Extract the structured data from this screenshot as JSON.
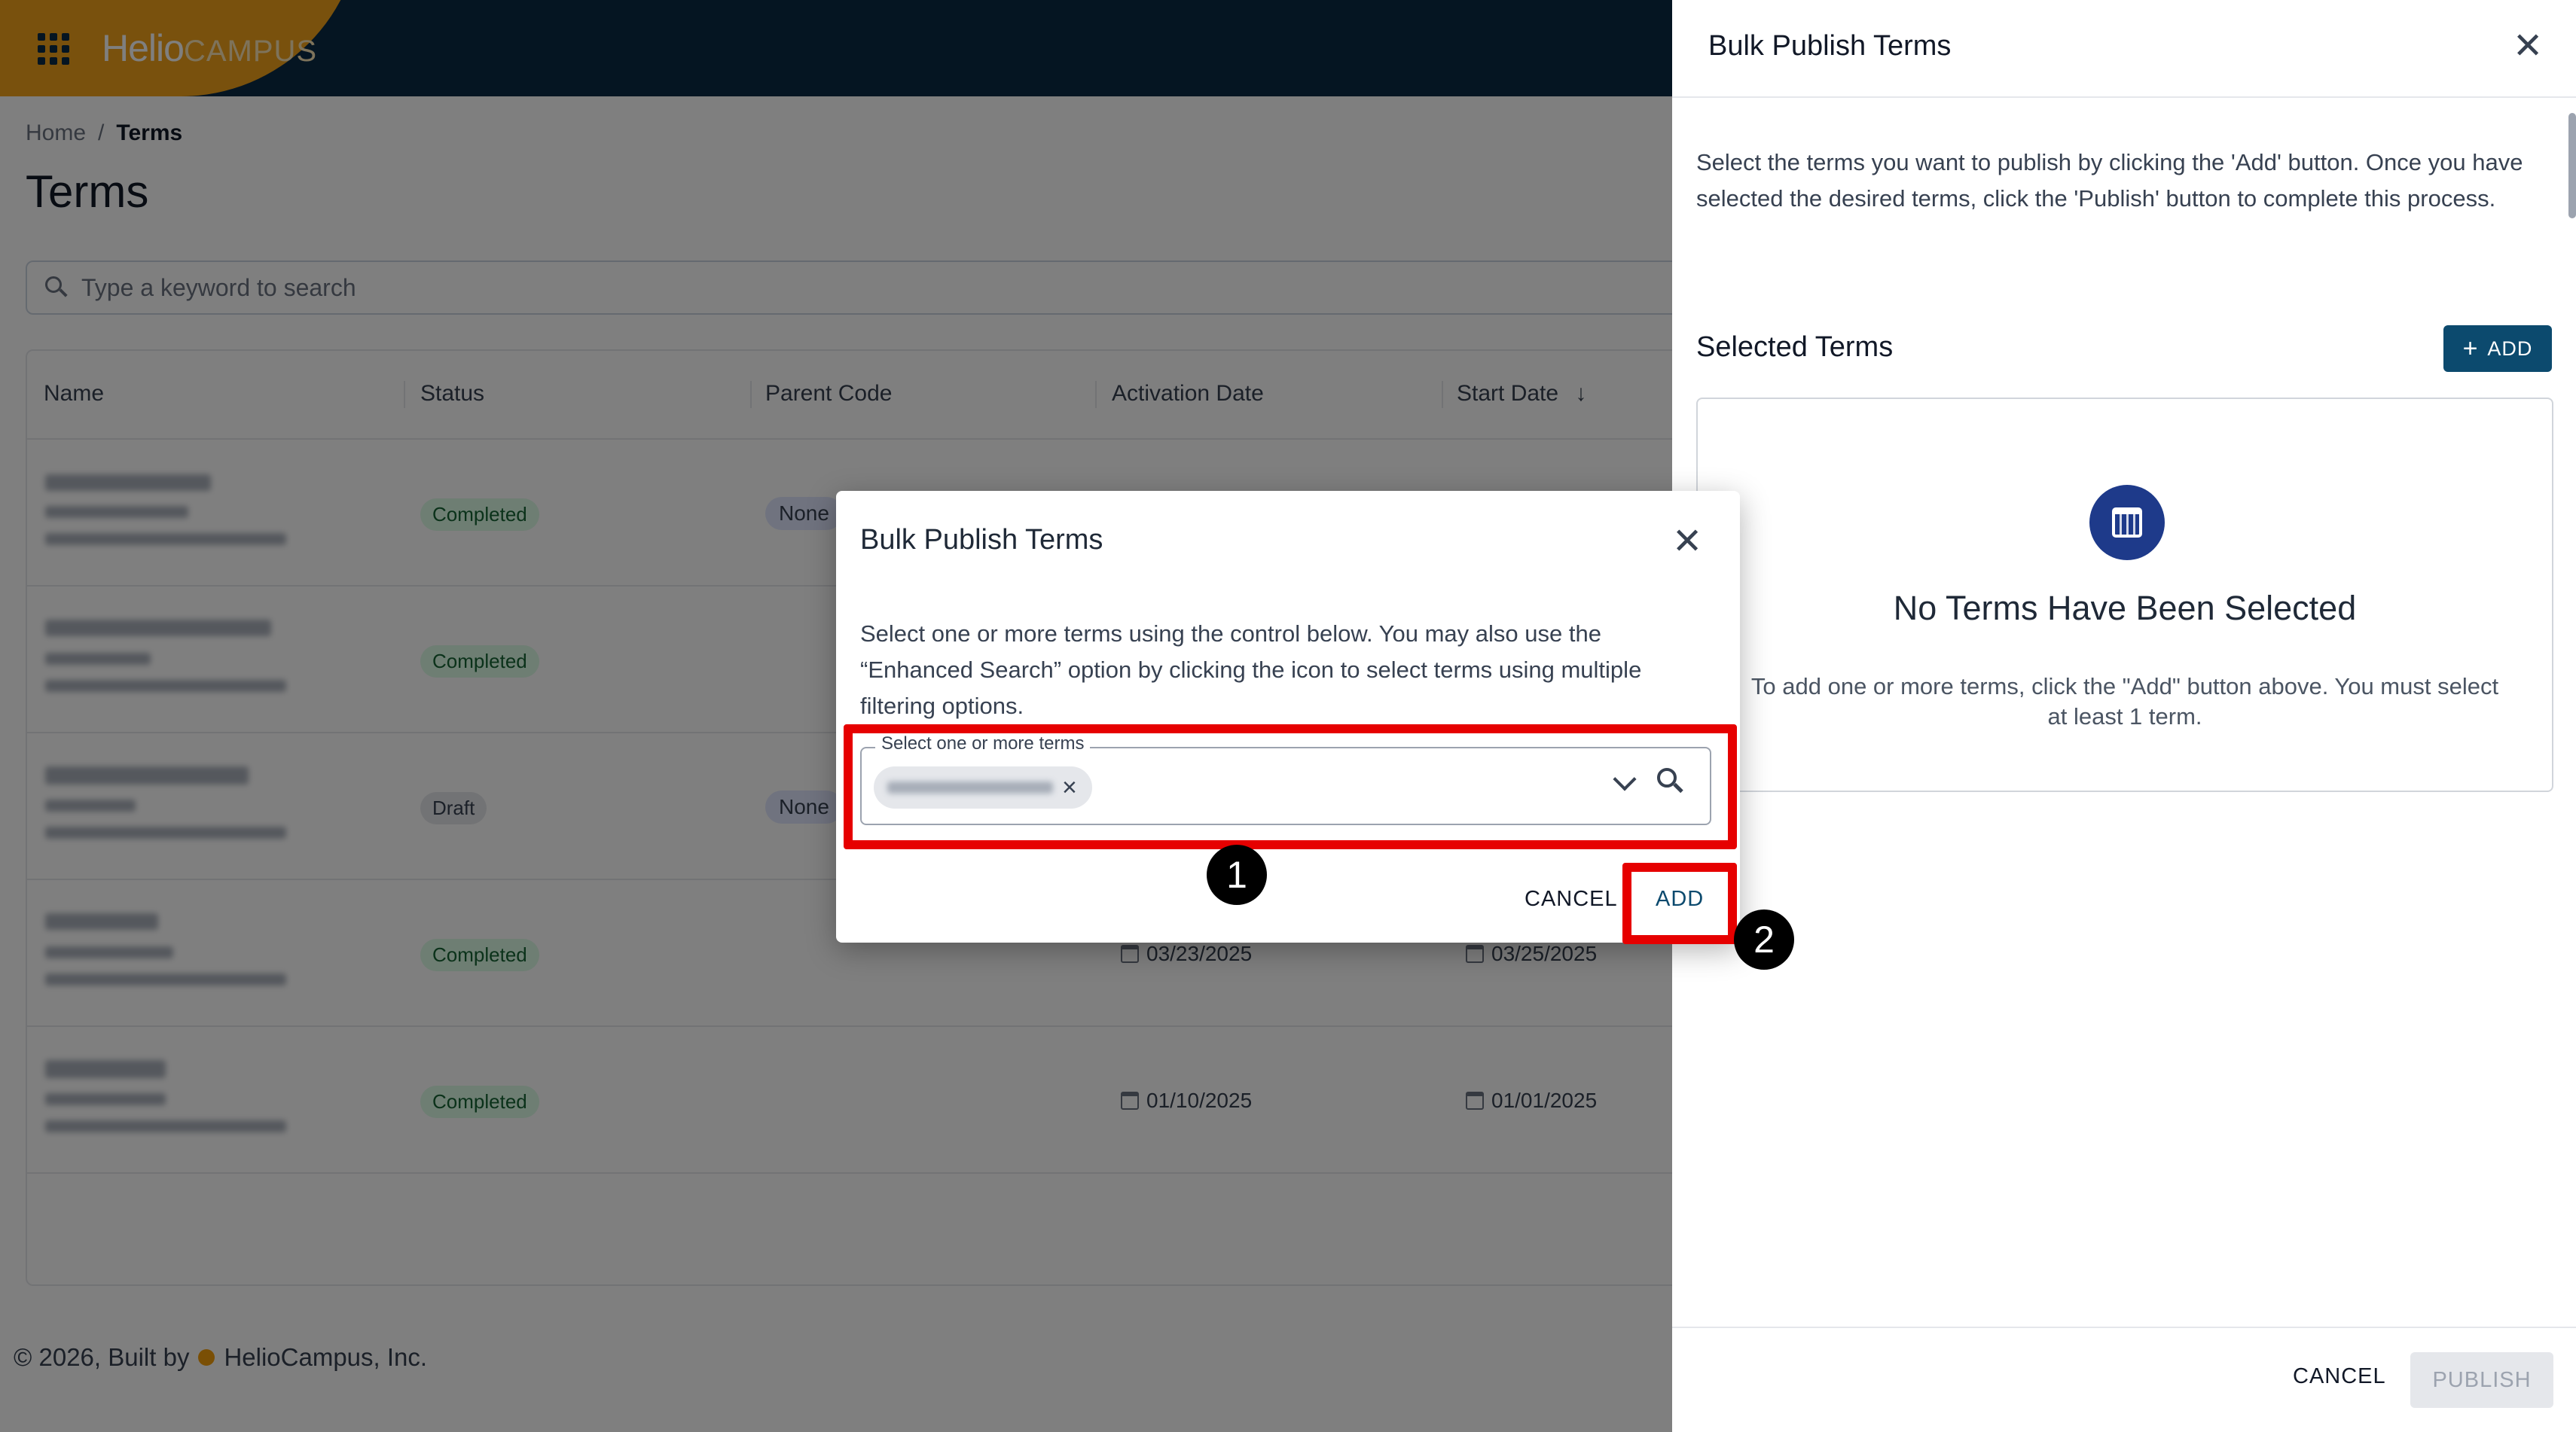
{
  "app": {
    "brand_main": "Helio",
    "brand_sub": "CAMPUS"
  },
  "breadcrumb": {
    "home": "Home",
    "sep": "/",
    "current": "Terms"
  },
  "page_title": "Terms",
  "search": {
    "placeholder": "Type a keyword to search"
  },
  "table": {
    "columns": [
      "Name",
      "Status",
      "Parent Code",
      "Activation Date",
      "Start Date"
    ],
    "rows": [
      {
        "status": "Completed",
        "parent": "None",
        "activation": "",
        "start": ""
      },
      {
        "status": "Completed",
        "parent": "",
        "activation": "",
        "start": ""
      },
      {
        "status": "Draft",
        "parent": "None",
        "activation": "",
        "start": ""
      },
      {
        "status": "Completed",
        "parent": "",
        "activation": "03/23/2025",
        "start": "03/25/2025"
      },
      {
        "status": "Completed",
        "parent": "",
        "activation": "01/10/2025",
        "start": "01/01/2025"
      }
    ]
  },
  "footer": {
    "prefix": "© 2026, Built by",
    "company": "HelioCampus, Inc."
  },
  "drawer": {
    "title": "Bulk Publish Terms",
    "description": "Select the terms you want to publish by clicking the 'Add' button. Once you have selected the desired terms, click the 'Publish' button to complete this process.",
    "selected_title": "Selected Terms",
    "add_label": "ADD",
    "empty_title": "No Terms Have Been Selected",
    "empty_desc": "To add one or more terms, click the \"Add\" button above. You must select at least 1 term.",
    "cancel_label": "CANCEL",
    "publish_label": "PUBLISH"
  },
  "modal": {
    "title": "Bulk Publish Terms",
    "description": "Select one or more terms using the control below. You may also use the “Enhanced Search” option by clicking the icon to select terms using multiple filtering options.",
    "field_label": "Select one or more terms",
    "cancel_label": "CANCEL",
    "add_label": "ADD"
  },
  "annotations": {
    "marker1": "1",
    "marker2": "2",
    "highlight_color": "#e60000"
  },
  "colors": {
    "navy": "#0b2a45",
    "accent": "#0c4a6e",
    "brand_orange": "#f2a31b"
  },
  "icons": [
    "apps-grid-icon",
    "search-icon",
    "sort-down-icon",
    "calendar-icon",
    "close-icon",
    "plus-icon",
    "chevron-down-icon",
    "magnifier-icon"
  ]
}
